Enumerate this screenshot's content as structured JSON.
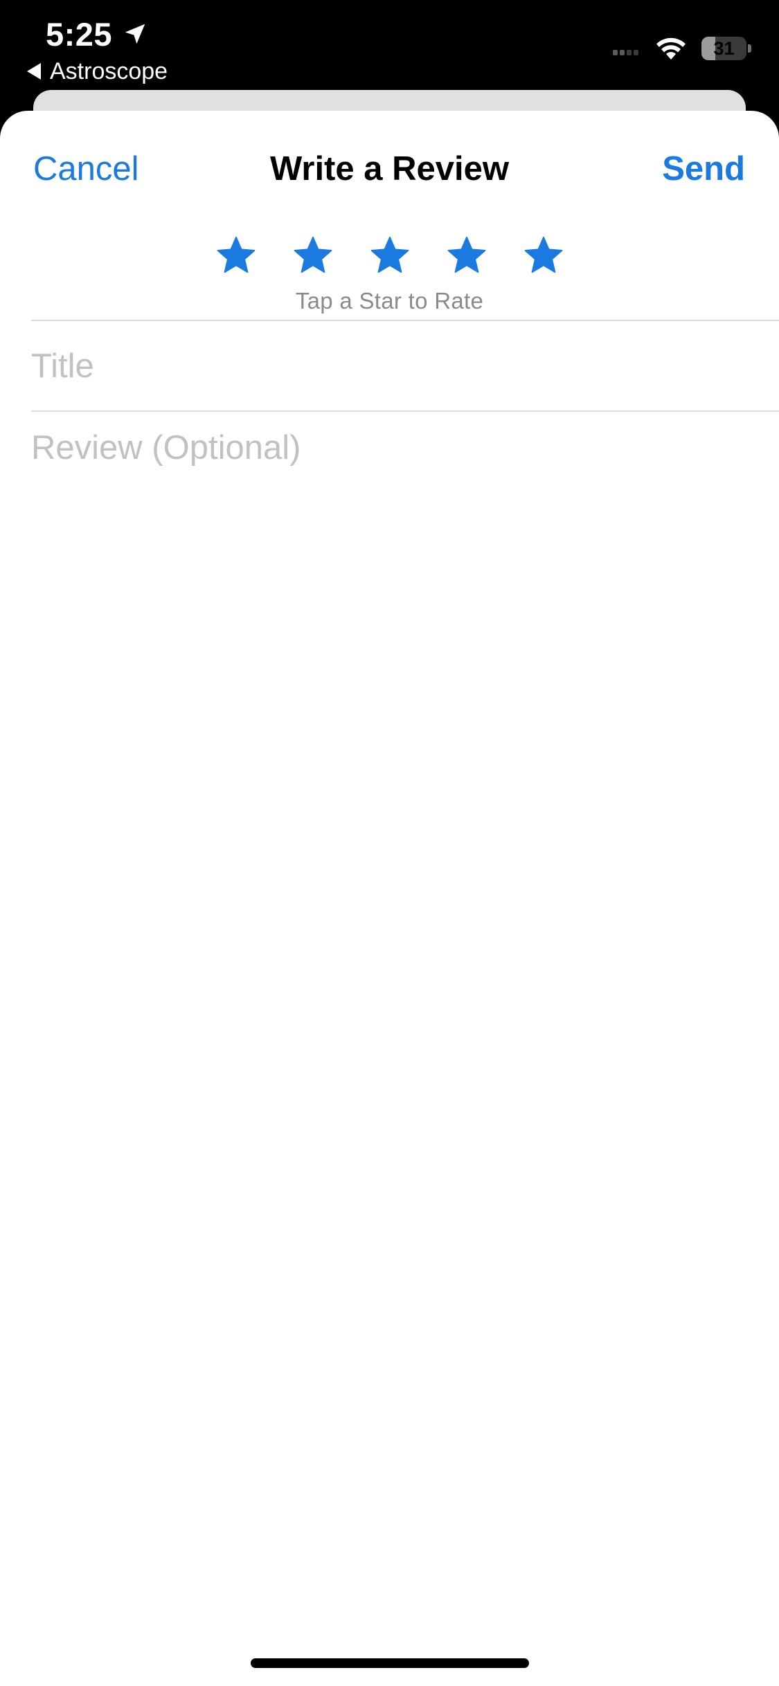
{
  "status_bar": {
    "time": "5:25",
    "back_app": "Astroscope",
    "battery_level": "31",
    "battery_fraction": 0.31,
    "icons": [
      "location-arrow-icon",
      "back-triangle-icon",
      "cellular-signal-icon",
      "wifi-icon",
      "battery-icon"
    ]
  },
  "nav": {
    "cancel_label": "Cancel",
    "title": "Write a Review",
    "send_label": "Send"
  },
  "rating": {
    "max_stars": 5,
    "selected": 0,
    "hint": "Tap a Star to Rate",
    "star_color": "#1a7ae0"
  },
  "form": {
    "title_placeholder": "Title",
    "title_value": "",
    "review_placeholder": "Review (Optional)",
    "review_value": ""
  },
  "colors": {
    "accent": "#1a7ae0",
    "background": "#ffffff",
    "status_bar_bg": "#000000",
    "placeholder": "#c1c1c4",
    "hint": "#8a8a8e"
  }
}
